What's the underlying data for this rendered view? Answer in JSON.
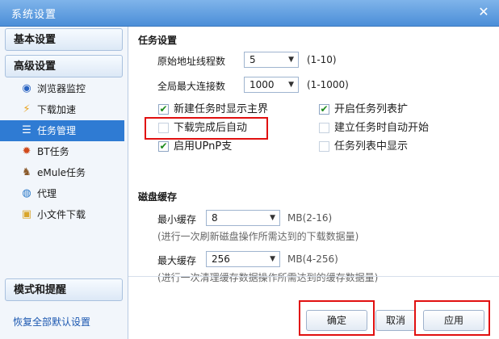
{
  "window": {
    "title": "系统设置",
    "close_glyph": "✕"
  },
  "sidebar": {
    "basic_label": "基本设置",
    "advanced_label": "高级设置",
    "items": [
      {
        "label": "浏览器监控",
        "icon": "browser-monitor-icon",
        "glyph": "◉"
      },
      {
        "label": "下载加速",
        "icon": "lightning-icon",
        "glyph": "⚡"
      },
      {
        "label": "任务管理",
        "icon": "task-list-icon",
        "glyph": "☰"
      },
      {
        "label": "BT任务",
        "icon": "bt-icon",
        "glyph": "✹"
      },
      {
        "label": "eMule任务",
        "icon": "emule-icon",
        "glyph": "♞"
      },
      {
        "label": "代理",
        "icon": "proxy-globe-icon",
        "glyph": "◍"
      },
      {
        "label": "小文件下载",
        "icon": "folder-icon",
        "glyph": "▣"
      }
    ],
    "mode_label": "模式和提醒",
    "restore_link": "恢复全部默认设置"
  },
  "task_settings": {
    "title": "任务设置",
    "origin_threads_label": "原始地址线程数",
    "origin_threads_value": "5",
    "origin_threads_range": "(1-10)",
    "max_connections_label": "全局最大连接数",
    "max_connections_value": "1000",
    "max_connections_range": "(1-1000)",
    "checks": [
      {
        "label": "新建任务时显示主界",
        "checked": "✔"
      },
      {
        "label": "开启任务列表扩",
        "checked": "✔"
      },
      {
        "label": "下载完成后自动",
        "checked": ""
      },
      {
        "label": "建立任务时自动开始",
        "checked": ""
      },
      {
        "label": "启用UPnP支",
        "checked": "✔"
      },
      {
        "label": "任务列表中显示",
        "checked": ""
      }
    ]
  },
  "disk_cache": {
    "title": "磁盘缓存",
    "min_label": "最小缓存",
    "min_value": "8",
    "min_range": "MB(2-16)",
    "min_hint": "(进行一次刷新磁盘操作所需达到的下载数据量)",
    "max_label": "最大缓存",
    "max_value": "256",
    "max_range": "MB(4-256)",
    "max_hint": "(进行一次清理缓存数据操作所需达到的缓存数据量)"
  },
  "buttons": {
    "ok": "确定",
    "cancel": "取消",
    "apply": "应用"
  },
  "colors": {
    "title_bar": "#4b8ed8",
    "active_nav": "#2f7bd3",
    "highlight": "#e11010"
  }
}
